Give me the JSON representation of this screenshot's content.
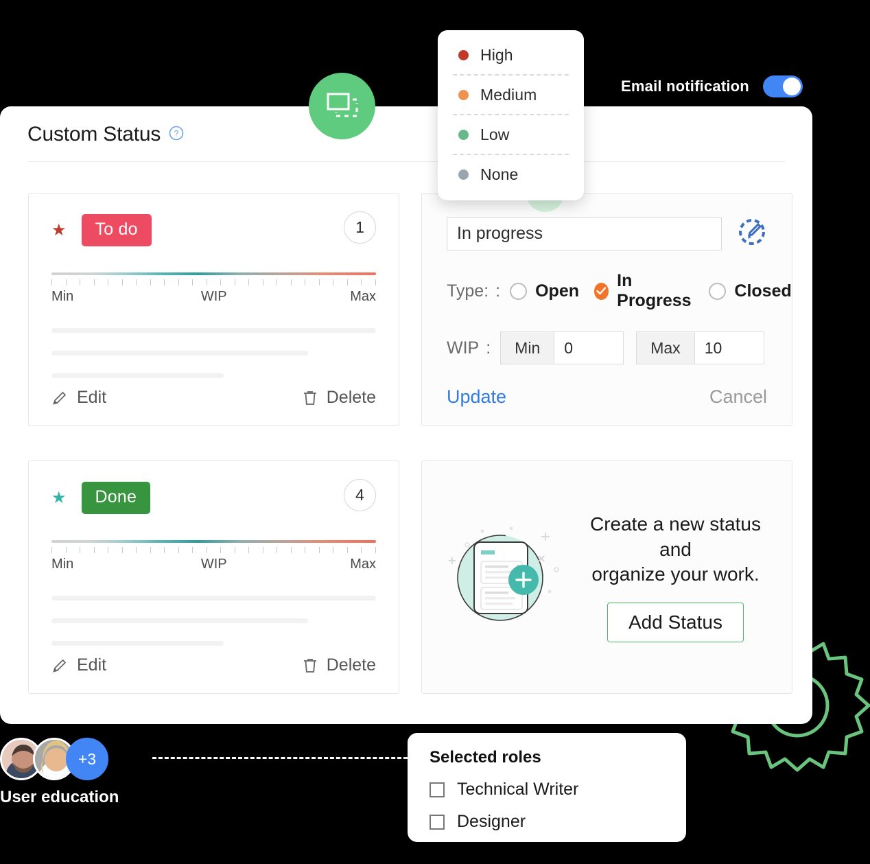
{
  "priority_menu": {
    "name": "priority-dropdown",
    "items": [
      {
        "label": "High",
        "color": "#c0392b"
      },
      {
        "label": "Medium",
        "color": "#f0924f"
      },
      {
        "label": "Low",
        "color": "#67b98a"
      },
      {
        "label": "None",
        "color": "#9aa5ad"
      }
    ]
  },
  "email_notification": {
    "label": "Email notification",
    "enabled": true,
    "accent": "#4285f4"
  },
  "duplicate_badge": {
    "icon": "duplicate-icon",
    "color": "#5fcb7f"
  },
  "panel": {
    "title": "Custom Status",
    "help_icon": "help-circle-icon"
  },
  "statuses": [
    {
      "label": "To do",
      "badge_color": "#ec4b62",
      "star_color": "#c0392b",
      "count": "1",
      "ruler": {
        "min": "Min",
        "wip": "WIP",
        "max": "Max"
      },
      "edit_label": "Edit",
      "delete_label": "Delete"
    },
    {
      "label": "Done",
      "badge_color": "#37953f",
      "star_color": "#34b5ab",
      "count": "4",
      "ruler": {
        "min": "Min",
        "wip": "WIP",
        "max": "Max"
      },
      "edit_label": "Edit",
      "delete_label": "Delete"
    }
  ],
  "edit_form": {
    "name_value": "In progress",
    "color_picker_icon": "color-picker-icon",
    "add_icon": "plus-icon",
    "type_label": "Type:",
    "colon": ":",
    "type_options": [
      {
        "label": "Open",
        "selected": false
      },
      {
        "label": "In Progress",
        "selected": true
      },
      {
        "label": "Closed",
        "selected": false
      }
    ],
    "wip_label": "WIP",
    "min_label": "Min",
    "min_value": "0",
    "max_label": "Max",
    "max_value": "10",
    "update_label": "Update",
    "cancel_label": "Cancel",
    "selected_accent": "#f2742a",
    "update_color": "#2f7de1"
  },
  "empty_state": {
    "line1": "Create a new status and",
    "line2": "organize your work.",
    "button_label": "Add Status",
    "button_border": "#4cb96a",
    "illustration": "new-status-illustration"
  },
  "people": {
    "extra_count": "+3",
    "caption": "User education"
  },
  "roles_panel": {
    "title": "Selected roles",
    "items": [
      {
        "label": "Technical Writer",
        "checked": false
      },
      {
        "label": "Designer",
        "checked": false
      }
    ]
  },
  "decoration": {
    "gear_color": "#6ac47e"
  }
}
